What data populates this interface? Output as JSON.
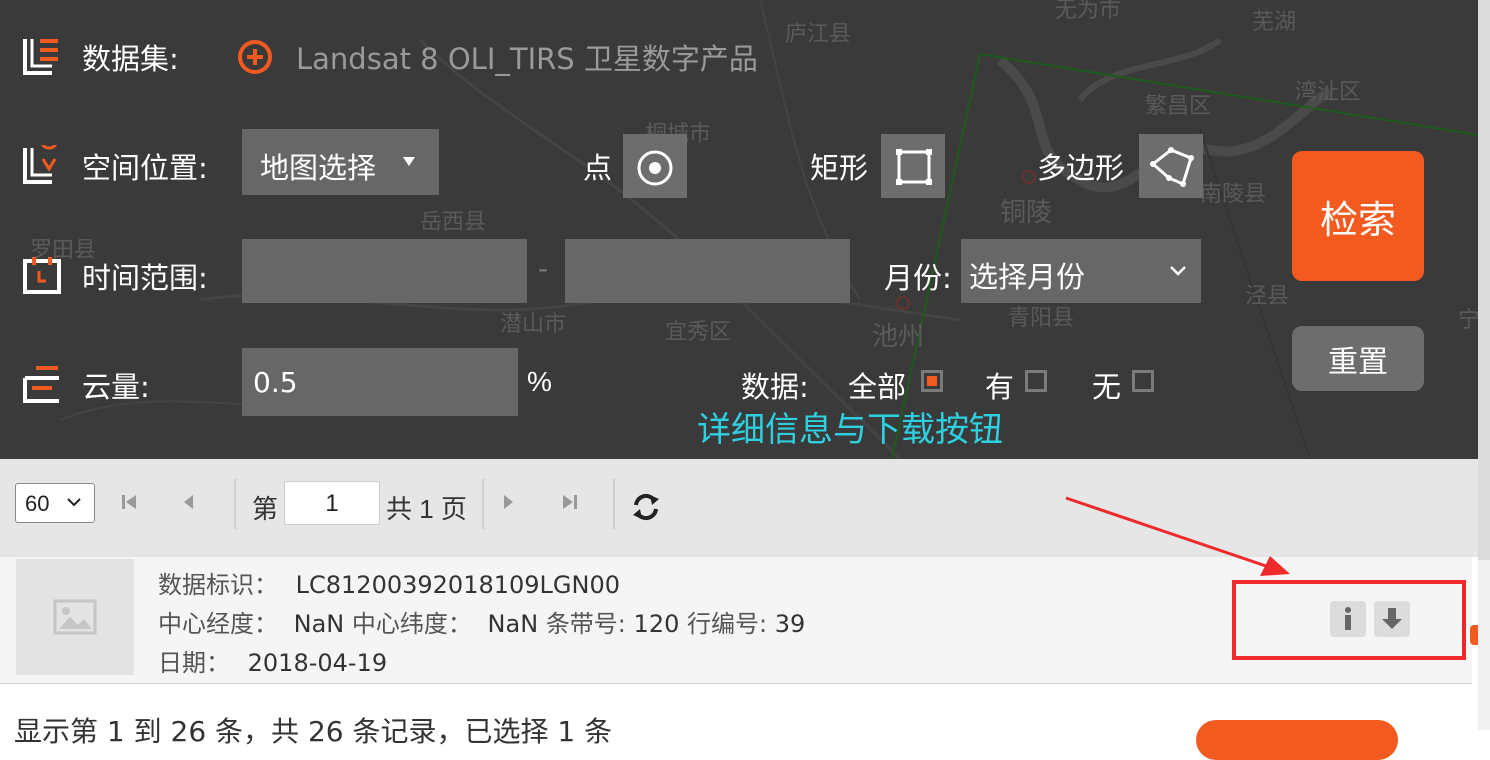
{
  "map": {
    "labels": [
      "无为市",
      "芜湖",
      "庐江县",
      "繁昌区",
      "湾沚区",
      "桐城市",
      "南陵县",
      "岳西县",
      "铜陵",
      "罗田县",
      "潜山市",
      "宜秀区",
      "池州",
      "泾县",
      "青阳县",
      "宁"
    ]
  },
  "search_panel": {
    "dataset": {
      "label": "数据集:",
      "value": "Landsat 8 OLI_TIRS 卫星数字产品"
    },
    "location": {
      "label": "空间位置:",
      "select_value": "地图选择",
      "point_label": "点",
      "rect_label": "矩形",
      "polygon_label": "多边形"
    },
    "time": {
      "label": "时间范围:",
      "start_value": "",
      "separator": "-",
      "end_value": "",
      "month_label": "月份:",
      "month_select": "选择月份"
    },
    "cloud": {
      "label": "云量:",
      "value": "0.5",
      "unit": "%",
      "data_label": "数据:",
      "options": [
        {
          "label": "全部",
          "checked": true
        },
        {
          "label": "有",
          "checked": false
        },
        {
          "label": "无",
          "checked": false
        }
      ]
    },
    "search_button": "检索",
    "reset_button": "重置",
    "accent_color": "#f25a1f"
  },
  "annotation": {
    "text": "详细信息与下载按钮",
    "color": "#2ed0e0",
    "box_color": "#ee2a2a"
  },
  "pager": {
    "page_size": "60",
    "page_prefix": "第",
    "page_value": "1",
    "page_suffix": "共 1 页"
  },
  "results": [
    {
      "id_label": "数据标识：",
      "id_value": "LC81200392018109LGN00",
      "lon_label": "中心经度：",
      "lon_value": "NaN",
      "lat_label": "中心纬度：",
      "lat_value": "NaN",
      "path_label": "条带号:",
      "path_value": "120",
      "row_label": "行编号:",
      "row_value": "39",
      "date_label": "日期：",
      "date_value": "2018-04-19"
    }
  ],
  "footer": {
    "summary": "显示第 1 到 26 条，共 26 条记录，已选择 1 条"
  }
}
